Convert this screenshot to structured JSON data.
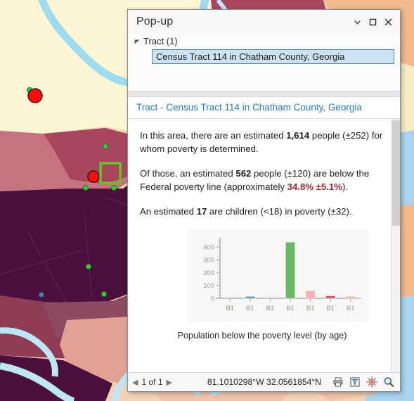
{
  "window": {
    "title": "Pop-up",
    "controls": {
      "collapse": "chevron-down",
      "maximize": "maximize",
      "close": "close"
    }
  },
  "tree": {
    "group_label": "Tract (1)",
    "selected_item": "Census Tract 114 in Chatham County, Georgia"
  },
  "feature": {
    "header": "Tract - Census Tract 114 in Chatham County, Georgia"
  },
  "content": {
    "paragraph1": {
      "part1": "In this area, there are an estimated ",
      "value1": "1,614",
      "part2": " people (±252) for whom poverty is determined."
    },
    "paragraph2": {
      "part1": "Of those, an estimated ",
      "value1": "562",
      "part2": " people (±120) are below the Federal poverty line (approximately ",
      "percent": "34.8% ±5.1%",
      "part3": ")."
    },
    "paragraph3": {
      "part1": "An estimated ",
      "value1": "17",
      "part2": " are children (<18) in poverty (±32)."
    }
  },
  "chart_data": {
    "type": "bar",
    "title": "",
    "caption": "Population below the poverty level (by age)",
    "xlabel": "",
    "ylabel": "",
    "categories": [
      "B1",
      "B1",
      "B1",
      "B1",
      "B1",
      "B1",
      "B1"
    ],
    "values": [
      0,
      14,
      0,
      437,
      58,
      19,
      15
    ],
    "colors": [
      "#9d9d9d",
      "#4f90c4",
      "#9d9d9d",
      "#6ab765",
      "#f8b0b0",
      "#dc4c4c",
      "#f8c478"
    ],
    "ylim": [
      0,
      460
    ],
    "yticks": [
      0,
      100,
      200,
      300,
      400
    ],
    "ytick_labels": [
      "0",
      "100",
      "200",
      "300",
      "400"
    ],
    "grid": false,
    "legend": "none"
  },
  "statusbar": {
    "page_label": "1 of 1",
    "prev_arrow": "◀",
    "next_arrow": "▶",
    "coordinates": "81.1010298°W 32.0561854°N",
    "icons": [
      "print-icon",
      "select-features-icon",
      "zoom-to-icon",
      "magnifier-icon"
    ]
  },
  "theme": {
    "link_blue": "#2a7ab9",
    "selection_blue": "#cde3f4",
    "accent_red": "#9a2b2b",
    "panel_bg": "#ffffff",
    "chart_bg": "#f7f7f7"
  }
}
